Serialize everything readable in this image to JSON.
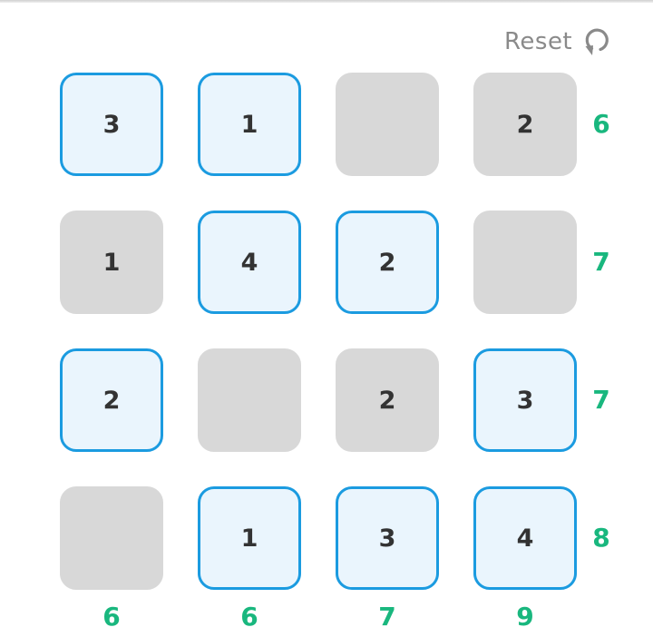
{
  "header": {
    "reset_label": "Reset",
    "reset_icon": "refresh-icon"
  },
  "grid": {
    "rows": [
      [
        {
          "value": "3",
          "selected": true
        },
        {
          "value": "1",
          "selected": true
        },
        {
          "value": "",
          "selected": false
        },
        {
          "value": "2",
          "selected": false
        }
      ],
      [
        {
          "value": "1",
          "selected": false
        },
        {
          "value": "4",
          "selected": true
        },
        {
          "value": "2",
          "selected": true
        },
        {
          "value": "",
          "selected": false
        }
      ],
      [
        {
          "value": "2",
          "selected": true
        },
        {
          "value": "",
          "selected": false
        },
        {
          "value": "2",
          "selected": false
        },
        {
          "value": "3",
          "selected": true
        }
      ],
      [
        {
          "value": "",
          "selected": false
        },
        {
          "value": "1",
          "selected": true
        },
        {
          "value": "3",
          "selected": true
        },
        {
          "value": "4",
          "selected": true
        }
      ]
    ],
    "row_sums": [
      "6",
      "7",
      "7",
      "8"
    ],
    "col_sums": [
      "6",
      "6",
      "7",
      "9"
    ]
  },
  "colors": {
    "selected_border": "#1b9be0",
    "selected_fill": "#eaf5fd",
    "unselected_fill": "#d8d8d8",
    "sum_text": "#19b77e",
    "tile_text": "#333333"
  }
}
